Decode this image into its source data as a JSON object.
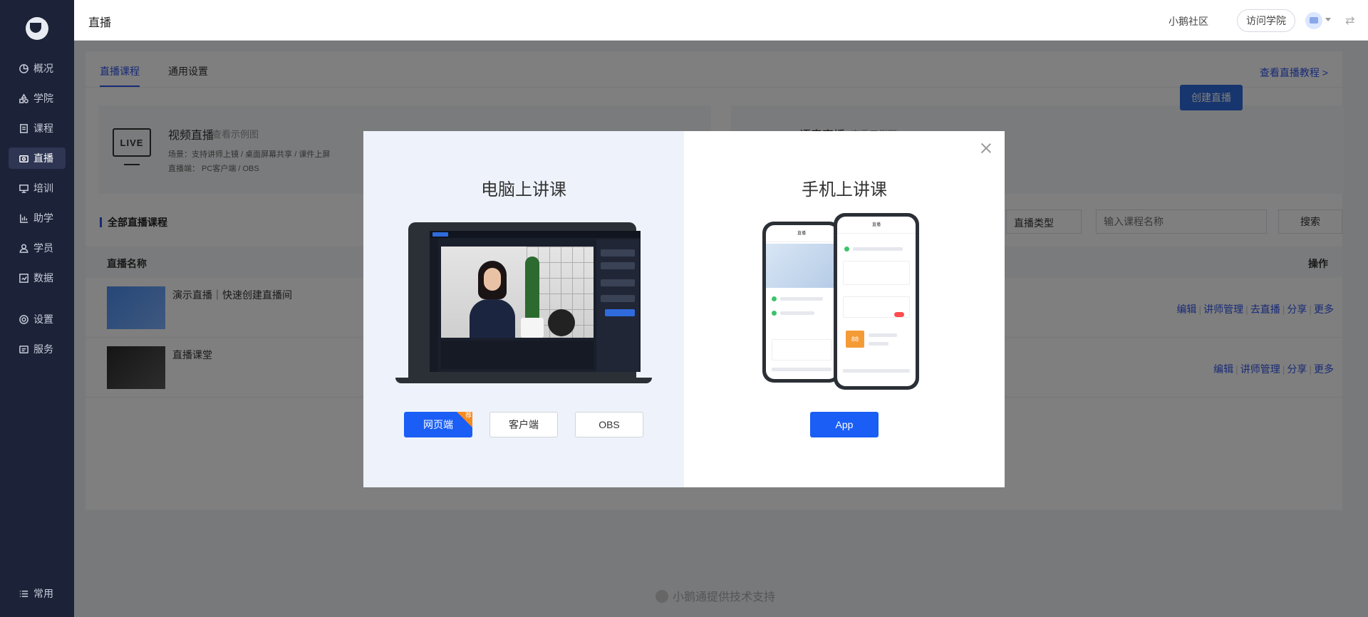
{
  "sidebar": {
    "items": [
      {
        "label": "概况",
        "icon": "pie-chart-icon"
      },
      {
        "label": "学院",
        "icon": "shapes-icon"
      },
      {
        "label": "课程",
        "icon": "document-icon"
      },
      {
        "label": "直播",
        "icon": "live-video-icon",
        "active": true
      },
      {
        "label": "培训",
        "icon": "presentation-board-icon"
      },
      {
        "label": "助学",
        "icon": "bar-chart-icon"
      },
      {
        "label": "学员",
        "icon": "user-icon"
      },
      {
        "label": "数据",
        "icon": "data-report-icon"
      },
      {
        "label": "设置",
        "icon": "gear-icon"
      },
      {
        "label": "服务",
        "icon": "service-icon"
      }
    ],
    "bottom_item": {
      "label": "常用",
      "icon": "list-icon"
    }
  },
  "topbar": {
    "title": "直播",
    "community": "小鹅社区",
    "academy": "访问学院",
    "swap_glyph": "⇄"
  },
  "page": {
    "tabs": [
      {
        "label": "直播课程",
        "active": true
      },
      {
        "label": "通用设置",
        "active": false
      }
    ],
    "tutorial_link": "查看直播教程 >",
    "video_card": {
      "icon_text": "LIVE",
      "title": "视频直播",
      "example_link": "查看示例图",
      "scene": "场景：支持讲师上镜 / 桌面屏幕共享 / 课件上屏",
      "client": "直播端：  PC客户端 / OBS"
    },
    "audio_card": {
      "title": "语音直播",
      "example_link": "查看示例图"
    },
    "create_button": "创建直播",
    "section_title": "全部直播课程",
    "filter_type": "直播类型",
    "search_placeholder": "输入课程名称",
    "search_button": "搜索",
    "table": {
      "col_name": "直播名称",
      "col_ops": "操作",
      "rows": [
        {
          "name": "演示直播｜快速创建直播间",
          "actions": [
            "编辑",
            "讲师管理",
            "去直播",
            "分享",
            "更多"
          ]
        },
        {
          "name": "直播课堂",
          "actions": [
            "编辑",
            "讲师管理",
            "分享",
            "更多"
          ]
        }
      ]
    },
    "footer": "小鹅通提供技术支持"
  },
  "modal": {
    "left_title": "电脑上讲课",
    "right_title": "手机上讲课",
    "buttons_left": [
      {
        "label": "网页端",
        "primary": true,
        "badge": "荐"
      },
      {
        "label": "客户端",
        "primary": false
      },
      {
        "label": "OBS",
        "primary": false
      }
    ],
    "button_right": "App",
    "phone_header": "直播",
    "price_tag": "88",
    "colors": {
      "primary": "#1a5ef5",
      "badge": "#f68a1f",
      "left_panel_bg": "#eef3fb"
    }
  }
}
